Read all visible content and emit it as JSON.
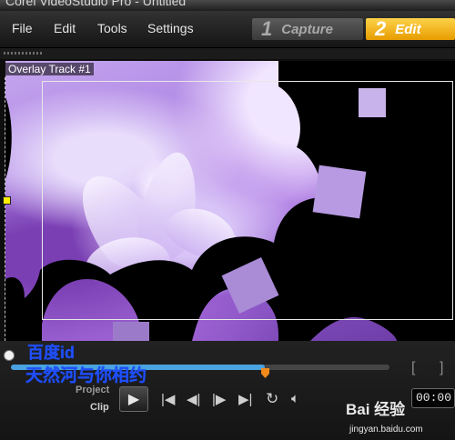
{
  "window": {
    "title": "Corel VideoStudio Pro - Untitled"
  },
  "menu": {
    "items": [
      "File",
      "Edit",
      "Tools",
      "Settings"
    ]
  },
  "steps": [
    {
      "num": "1",
      "label": "Capture"
    },
    {
      "num": "2",
      "label": "Edit"
    }
  ],
  "preview": {
    "overlay_label": "Overlay Track #1"
  },
  "transport": {
    "mode_project": "Project",
    "mode_clip": "Clip",
    "timecode": "00:00",
    "playback_progress": 0.67,
    "play_icon": "play-icon",
    "controls": [
      "home-icon",
      "prev-frame-icon",
      "next-frame-icon",
      "end-icon",
      "repeat-icon",
      "volume-icon"
    ],
    "trim_brackets": [
      "[",
      "]"
    ]
  },
  "watermark": {
    "line1": "百度id",
    "line2": "天然河与你相约",
    "brand": "Bai 经验",
    "brand_url": "jingyan.baidu.com"
  },
  "colors": {
    "edit_accent": "#f2b200",
    "progress": "#4aa3e0",
    "trim_marker": "#f08a1a",
    "handle": "#ffec00"
  }
}
